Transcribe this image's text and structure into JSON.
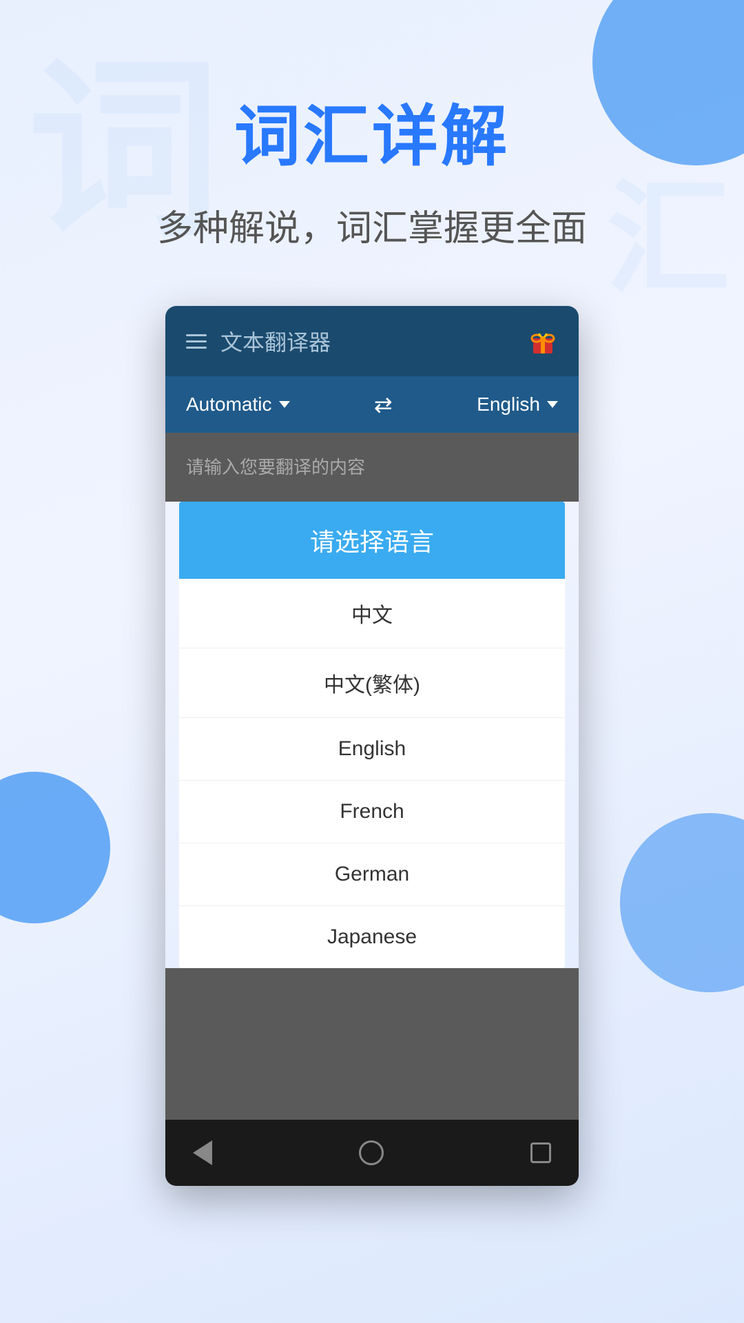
{
  "background": {
    "watermark": "词"
  },
  "header": {
    "main_title": "词汇详解",
    "sub_title": "多种解说，词汇掌握更全面"
  },
  "app_bar": {
    "title": "文本翻译器",
    "gift_label": "gift"
  },
  "lang_bar": {
    "source_lang": "Automatic",
    "target_lang": "English",
    "swap_symbol": "⇄"
  },
  "content_area": {
    "placeholder": "请输入您要翻译的内容"
  },
  "dialog": {
    "title": "请选择语言",
    "options": [
      {
        "id": "zh",
        "label": "中文"
      },
      {
        "id": "zh-tw",
        "label": "中文(繁体)"
      },
      {
        "id": "en",
        "label": "English"
      },
      {
        "id": "fr",
        "label": "French"
      },
      {
        "id": "de",
        "label": "German"
      },
      {
        "id": "ja",
        "label": "Japanese"
      }
    ]
  },
  "nav_bar": {
    "back": "back",
    "home": "home",
    "recents": "recents"
  }
}
